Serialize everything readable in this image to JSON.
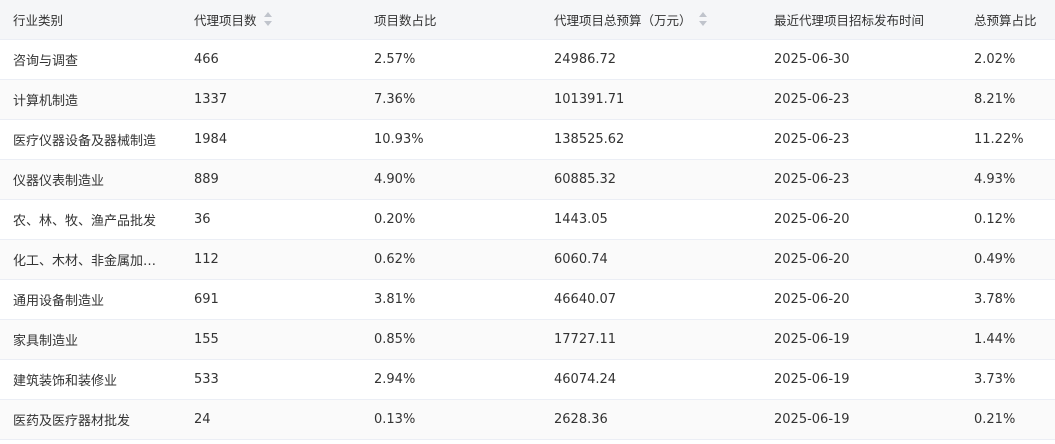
{
  "table": {
    "columns": [
      {
        "label": "行业类别",
        "sortable": false
      },
      {
        "label": "代理项目数",
        "sortable": true
      },
      {
        "label": "项目数占比",
        "sortable": false
      },
      {
        "label": "代理项目总预算（万元）",
        "sortable": true
      },
      {
        "label": "最近代理项目招标发布时间",
        "sortable": false
      },
      {
        "label": "总预算占比",
        "sortable": false
      }
    ],
    "rows": [
      [
        "咨询与调查",
        "466",
        "2.57%",
        "24986.72",
        "2025-06-30",
        "2.02%"
      ],
      [
        "计算机制造",
        "1337",
        "7.36%",
        "101391.71",
        "2025-06-23",
        "8.21%"
      ],
      [
        "医疗仪器设备及器械制造",
        "1984",
        "10.93%",
        "138525.62",
        "2025-06-23",
        "11.22%"
      ],
      [
        "仪器仪表制造业",
        "889",
        "4.90%",
        "60885.32",
        "2025-06-23",
        "4.93%"
      ],
      [
        "农、林、牧、渔产品批发",
        "36",
        "0.20%",
        "1443.05",
        "2025-06-20",
        "0.12%"
      ],
      [
        "化工、木材、非金属加…",
        "112",
        "0.62%",
        "6060.74",
        "2025-06-20",
        "0.49%"
      ],
      [
        "通用设备制造业",
        "691",
        "3.81%",
        "46640.07",
        "2025-06-20",
        "3.78%"
      ],
      [
        "家具制造业",
        "155",
        "0.85%",
        "17727.11",
        "2025-06-19",
        "1.44%"
      ],
      [
        "建筑装饰和装修业",
        "533",
        "2.94%",
        "46074.24",
        "2025-06-19",
        "3.73%"
      ],
      [
        "医药及医疗器材批发",
        "24",
        "0.13%",
        "2628.36",
        "2025-06-19",
        "0.21%"
      ]
    ]
  },
  "icons": {
    "sort": "sort-caret-icon"
  },
  "colors": {
    "header_bg": "#f5f6f8",
    "row_stripe": "#fafafa",
    "border": "#ebeef5",
    "text": "#333333",
    "sort_caret": "#c0c4cc"
  }
}
